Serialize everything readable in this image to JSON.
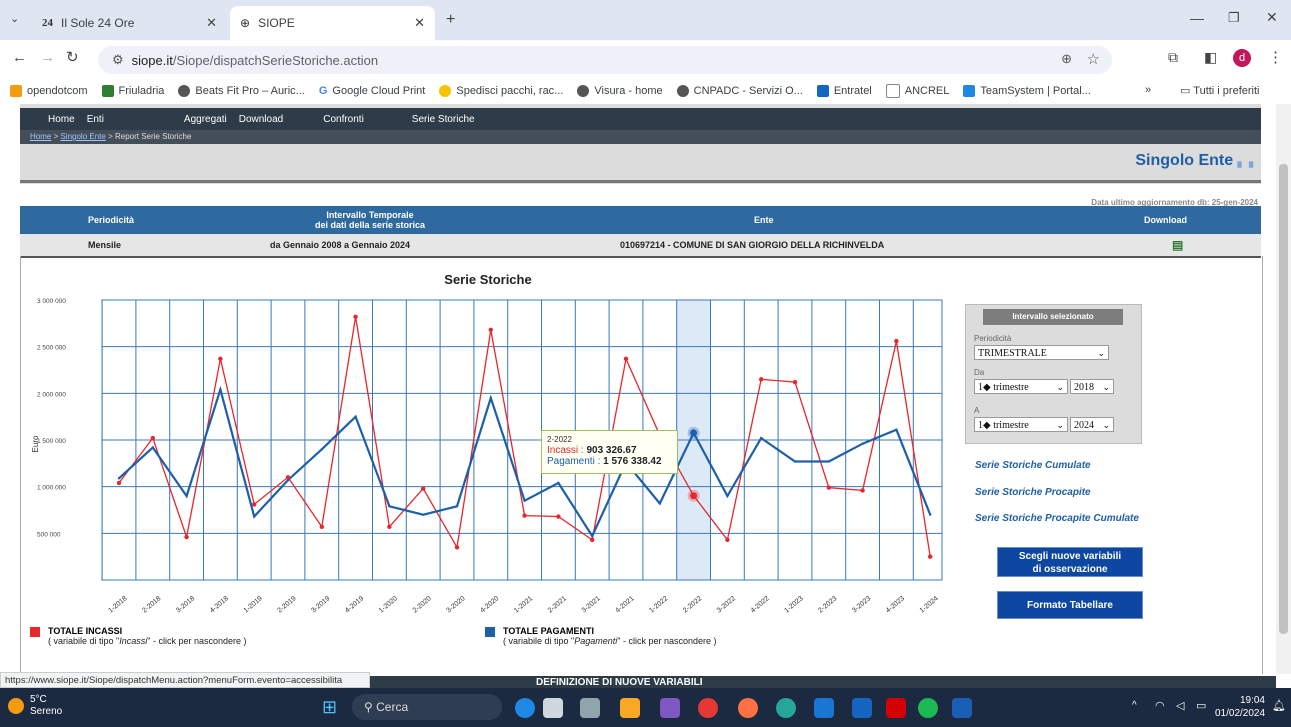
{
  "browser": {
    "tabs": [
      {
        "title": "Il Sole 24 Ore",
        "active": false
      },
      {
        "title": "SIOPE",
        "active": true
      }
    ],
    "url_host": "siope.it",
    "url_path": "/Siope/dispatchSerieStoriche.action",
    "bookmarks": [
      "opendotcom",
      "Friuladria",
      "Beats Fit Pro – Auric...",
      "Google Cloud Print",
      "Spedisci pacchi, rac...",
      "Visura - home",
      "CNPADC - Servizi O...",
      "Entratel",
      "ANCREL",
      "TeamSystem | Portal..."
    ],
    "bookmarks_more": "»",
    "all_bookmarks": "Tutti i preferiti",
    "profile_initial": "d",
    "status_url": "https://www.siope.it/Siope/dispatchMenu.action?menuForm.evento=accessibilita"
  },
  "site": {
    "nav": [
      "Home",
      "Enti",
      "Aggregati",
      "Download",
      "Confronti",
      "Serie Storiche"
    ],
    "breadcrumb": {
      "home": "Home",
      "sep": " > ",
      "ente": "Singolo Ente",
      "current": "Report Serie Storiche"
    },
    "section_title": "Singolo Ente",
    "last_update": "Data ultimo aggiornamento db: 25-gen-2024",
    "info_headers": {
      "periodicita": "Periodicità",
      "intervallo": "Intervallo Temporale",
      "intervallo2": "dei dati della serie storica",
      "ente": "Ente",
      "download": "Download"
    },
    "info_values": {
      "periodicita": "Mensile",
      "intervallo": "da Gennaio 2008 a Gennaio 2024",
      "ente": "010697214 - COMUNE DI SAN GIORGIO DELLA RICHINVELDA"
    },
    "next_section": "DEFINIZIONE DI NUOVE VARIABILI"
  },
  "side_panel": {
    "title": "Intervallo selezionato",
    "periodicita_label": "Periodicità",
    "periodicita_value": "TRIMESTRALE",
    "da_label": "Da",
    "da_quarter": "1◆ trimestre",
    "da_year": "2018",
    "a_label": "A",
    "a_quarter": "1◆ trimestre",
    "a_year": "2024",
    "links": [
      "Serie Storiche Cumulate",
      "Serie Storiche Procapite",
      "Serie Storiche Procapite Cumulate"
    ],
    "btn_variabili_1": "Scegli nuove variabili",
    "btn_variabili_2": "di osservazione",
    "btn_tabellare": "Formato Tabellare"
  },
  "legend": {
    "incassi_title": "TOTALE INCASSI",
    "incassi_sub_pre": "( variabile di tipo \"",
    "incassi_sub_em": "Incassi",
    "incassi_sub_post": "\" - click per nascondere )",
    "pagamenti_title": "TOTALE PAGAMENTI",
    "pagamenti_sub_pre": "( variabile di tipo \"",
    "pagamenti_sub_em": "Pagamenti",
    "pagamenti_sub_post": "\" - click per nascondere )"
  },
  "tooltip": {
    "period": "2-2022",
    "incassi_label": "Incassi : ",
    "incassi_value": "903 326.67",
    "pagamenti_label": "Pagamenti : ",
    "pagamenti_value": "1 576 338.42"
  },
  "chart_data": {
    "type": "line",
    "title": "Serie Storiche",
    "ylabel": "Euro",
    "ylim": [
      0,
      3000000
    ],
    "y_ticks": [
      "500 000",
      "1 000 000",
      "1 500 000",
      "2 000 000",
      "2 500 000",
      "3 000 000"
    ],
    "y_tick_values": [
      500000,
      1000000,
      1500000,
      2000000,
      2500000,
      3000000
    ],
    "categories": [
      "1-2018",
      "2-2018",
      "3-2018",
      "4-2018",
      "1-2019",
      "2-2019",
      "3-2019",
      "4-2019",
      "1-2020",
      "2-2020",
      "3-2020",
      "4-2020",
      "1-2021",
      "2-2021",
      "3-2021",
      "4-2021",
      "1-2022",
      "2-2022",
      "3-2022",
      "4-2022",
      "1-2023",
      "2-2023",
      "3-2023",
      "4-2023",
      "1-2024"
    ],
    "highlight_category": "2-2022",
    "grid": true,
    "series": [
      {
        "name": "TOTALE INCASSI",
        "color": "#e8262b",
        "values": [
          1040000,
          1520000,
          460000,
          2370000,
          810000,
          1100000,
          570000,
          2820000,
          570000,
          980000,
          350000,
          2680000,
          690000,
          680000,
          430000,
          2370000,
          1550000,
          903326.67,
          430000,
          2150000,
          2120000,
          990000,
          960000,
          2560000,
          250000
        ]
      },
      {
        "name": "TOTALE PAGAMENTI",
        "color": "#1d5fa8",
        "values": [
          1090000,
          1420000,
          900000,
          2040000,
          680000,
          1070000,
          1400000,
          1750000,
          790000,
          700000,
          790000,
          1950000,
          850000,
          1040000,
          470000,
          1260000,
          820000,
          1576338.42,
          900000,
          1520000,
          1270000,
          1270000,
          1460000,
          1610000,
          700000
        ]
      }
    ]
  },
  "taskbar": {
    "weather_temp": "5°C",
    "weather_desc": "Sereno",
    "search_placeholder": "Cerca",
    "time": "19:04",
    "date": "01/02/2024"
  },
  "colors": {
    "brand_blue": "#2e6aa0",
    "nav_dark": "#2e3b48",
    "button_blue": "#0d47a1"
  }
}
